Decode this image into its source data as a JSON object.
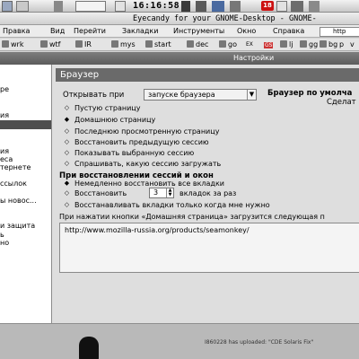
{
  "panel": {
    "clock": "16:16:58",
    "badge_weather": "18"
  },
  "window": {
    "title": "Eyecandy for your GNOME-Desktop - GNOME-"
  },
  "menu": {
    "items": [
      "Правка",
      "Вид",
      "Перейти",
      "Закладки",
      "Инструменты",
      "Окно",
      "Справка"
    ],
    "url_fragment": "http"
  },
  "bookmarks": {
    "items": [
      "wrk",
      "wtf",
      "IR",
      "mys",
      "start",
      "dec",
      "go",
      "EX",
      "GS",
      "lj",
      "gg",
      "bg",
      "p",
      "v"
    ]
  },
  "dialog": {
    "title": "Настройки"
  },
  "sidebar": {
    "items": [
      "ре",
      "",
      "ия",
      "",
      "",
      "ия",
      "еса",
      "тернете",
      "",
      "ссылок",
      "",
      "ы новос...",
      "",
      "и защита",
      "ь",
      "но"
    ]
  },
  "browser": {
    "header": "Браузер",
    "open_label": "Открывать при",
    "open_value": "запуске браузера",
    "default_browser": "Браузер по умолча",
    "default_button": "Сделат",
    "start_options": [
      "Пустую страницу",
      "Домашнюю страницу",
      "Последнюю просмотренную страницу",
      "Восстановить предыдущую сессию",
      "Показывать выбранную сессию",
      "Спрашивать, какую сессию загружать"
    ],
    "restore_title": "При восстановлении сессий и окон",
    "restore_now": "Немедленно восстановить все вкладки",
    "restore_n_label": "Восстановить",
    "restore_n_value": "3",
    "restore_n_suffix": "вкладок за раз",
    "restore_lazy": "Восстанавливать вкладки только когда мне нужно",
    "home_label": "При нажатии кнопки «Домашняя страница» загрузится следующая п",
    "home_url": "http://www.mozilla-russia.org/products/seamonkey/"
  },
  "status": {
    "text": "I860228 has uploaded: \"CDE Solaris Fix\""
  }
}
